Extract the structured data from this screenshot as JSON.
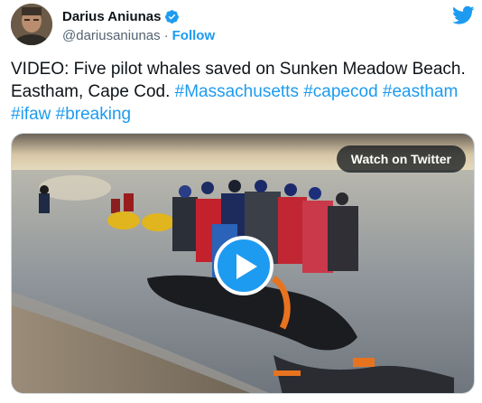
{
  "author": {
    "display_name": "Darius Aniunas",
    "handle": "@dariusaniunas",
    "separator": "·",
    "follow_label": "Follow"
  },
  "icons": {
    "verified": "verified-badge-icon",
    "brand": "twitter-bird-icon",
    "play": "play-icon"
  },
  "tweet": {
    "text_plain": "VIDEO: Five pilot whales saved on Sunken Meadow Beach. Eastham, Cape Cod. ",
    "hashtags": [
      "#Massachusetts",
      "#capecod",
      "#eastham",
      "#ifaw",
      "#breaking"
    ]
  },
  "media": {
    "watch_label": "Watch on Twitter"
  },
  "colors": {
    "accent": "#1d9bf0",
    "text": "#0f1419",
    "secondary_text": "#536471"
  }
}
